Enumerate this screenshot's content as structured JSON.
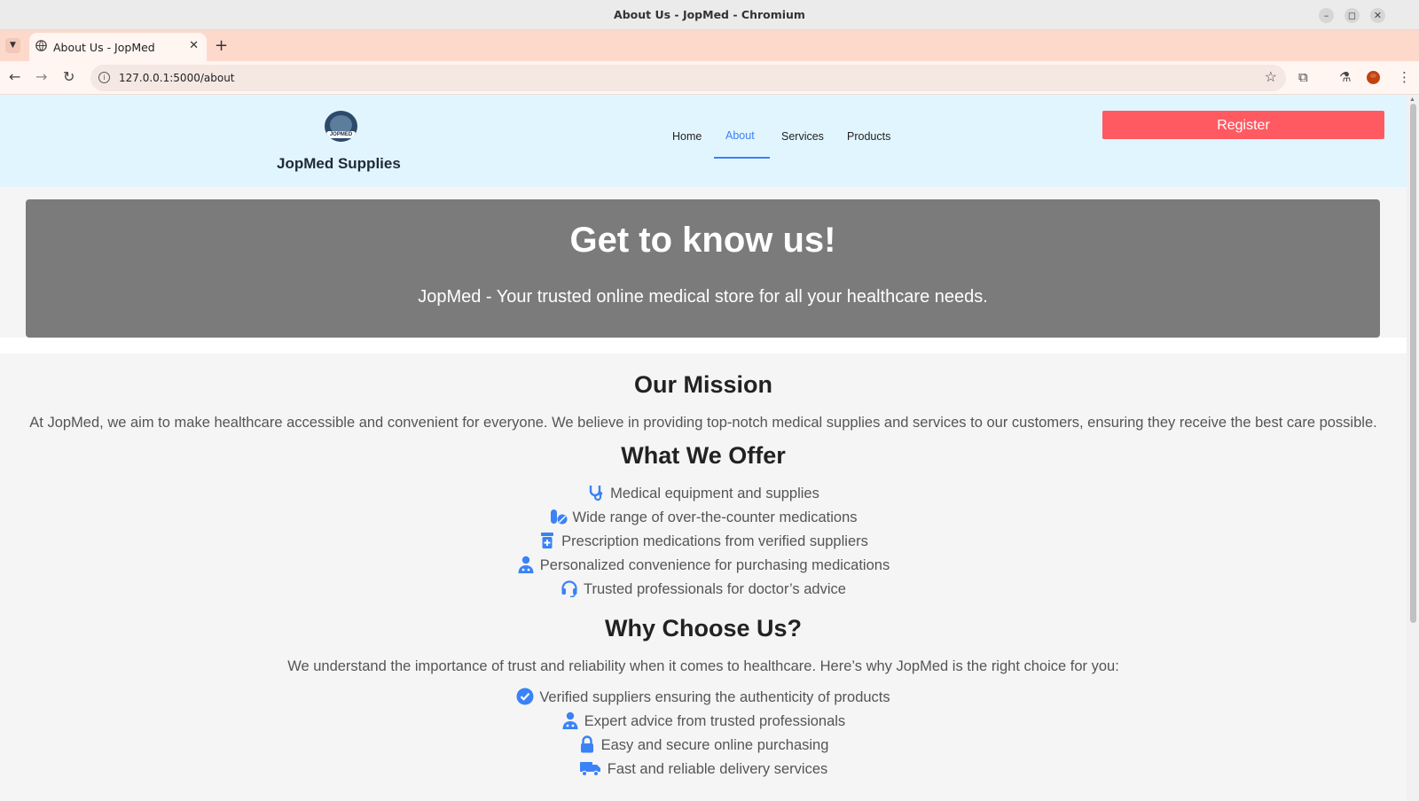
{
  "window": {
    "title": "About Us - JopMed - Chromium",
    "controls": [
      "minimize",
      "restore",
      "close"
    ]
  },
  "tab": {
    "title": "About Us - JopMed",
    "close_glyph": "✕",
    "new_tab_glyph": "+"
  },
  "addressbar": {
    "url": "127.0.0.1:5000/about"
  },
  "header": {
    "logo_text": "JOPMED",
    "brand": "JopMed Supplies",
    "nav": [
      "Home",
      "About",
      "Services",
      "Products"
    ],
    "active_nav": "About",
    "register_label": "Register"
  },
  "hero": {
    "title": "Get to know us!",
    "subtitle": "JopMed - Your trusted online medical store for all your healthcare needs."
  },
  "mission": {
    "heading": "Our Mission",
    "text": "At JopMed, we aim to make healthcare accessible and convenient for everyone. We believe in providing top-notch medical supplies and services to our customers, ensuring they receive the best care possible."
  },
  "offer": {
    "heading": "What We Offer",
    "items": [
      {
        "icon": "stethoscope-icon",
        "text": "Medical equipment and supplies"
      },
      {
        "icon": "pills-icon",
        "text": "Wide range of over-the-counter medications"
      },
      {
        "icon": "prescription-bottle-icon",
        "text": "Prescription medications from verified suppliers"
      },
      {
        "icon": "user-doctor-icon",
        "text": "Personalized convenience for purchasing medications"
      },
      {
        "icon": "headset-icon",
        "text": "Trusted professionals for doctor’s advice"
      }
    ]
  },
  "why": {
    "heading": "Why Choose Us?",
    "intro": "We understand the importance of trust and reliability when it comes to healthcare. Here’s why JopMed is the right choice for you:",
    "items": [
      {
        "icon": "check-circle-icon",
        "text": "Verified suppliers ensuring the authenticity of products"
      },
      {
        "icon": "user-doctor-icon",
        "text": "Expert advice from trusted professionals"
      },
      {
        "icon": "lock-icon",
        "text": "Easy and secure online purchasing"
      },
      {
        "icon": "truck-icon",
        "text": "Fast and reliable delivery services"
      }
    ]
  },
  "colors": {
    "accent": "#3b82f6",
    "header_bg": "#e1f5fe",
    "register_bg": "#ff5a62",
    "hero_bg": "#7b7b7b",
    "tabstrip_bg": "#fdd9cc"
  }
}
